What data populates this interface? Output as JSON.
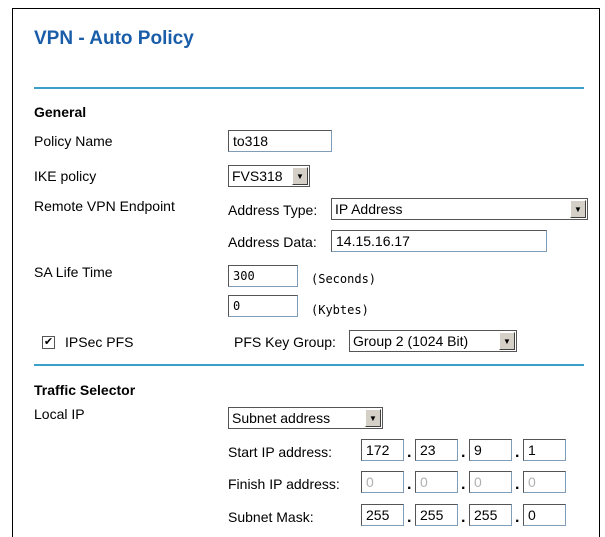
{
  "page_title": "VPN - Auto Policy",
  "general": {
    "heading": "General",
    "policy_name_label": "Policy Name",
    "policy_name_value": "to318",
    "ike_policy_label": "IKE policy",
    "ike_policy_value": "FVS318",
    "remote_endpoint_label": "Remote VPN Endpoint",
    "address_type_label": "Address Type:",
    "address_type_value": "IP Address",
    "address_data_label": "Address Data:",
    "address_data_value": "14.15.16.17",
    "sa_lifetime_label": "SA Life Time",
    "sa_seconds_value": "300",
    "sa_seconds_unit": "(Seconds)",
    "sa_kbytes_value": "0",
    "sa_kbytes_unit": "(Kybtes)",
    "ipsec_pfs_label": "IPSec PFS",
    "ipsec_pfs_checked": true,
    "pfs_key_group_label": "PFS Key Group:",
    "pfs_key_group_value": "Group 2 (1024 Bit)"
  },
  "traffic_selector": {
    "heading": "Traffic Selector",
    "local_ip_label": "Local IP",
    "local_ip_type_value": "Subnet address",
    "start_ip_label": "Start IP address:",
    "start_ip": [
      "172",
      "23",
      "9",
      "1"
    ],
    "finish_ip_label": "Finish IP address:",
    "finish_ip": [
      "0",
      "0",
      "0",
      "0"
    ],
    "subnet_mask_label": "Subnet Mask:",
    "subnet_mask": [
      "255",
      "255",
      "255",
      "0"
    ]
  },
  "colors": {
    "title": "#1a5da8",
    "divider": "#3aa0c8"
  }
}
